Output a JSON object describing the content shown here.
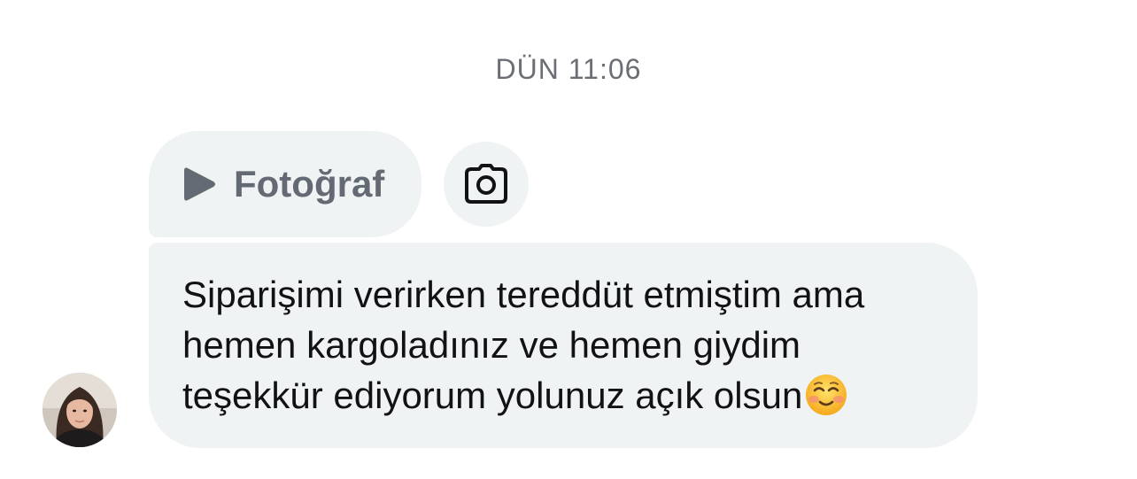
{
  "conversation": {
    "timestamp": "DÜN 11:06"
  },
  "photo_message": {
    "label": "Fotoğraf",
    "icon": "play-icon"
  },
  "camera_button": {
    "icon": "camera-icon"
  },
  "text_message": {
    "lines": [
      "Siparişimi verirken tereddüt etmiştim ama",
      "hemen kargoladınız ve hemen giydim",
      "teşekkür ediyorum yolunuz açık olsun"
    ],
    "emoji": "smiling-face-icon"
  },
  "sender": {
    "avatar": "avatar-photo"
  },
  "colors": {
    "bubble_bg": "#f0f3f4",
    "timestamp_text": "#6b6e74",
    "message_text": "#111214",
    "photo_label": "#646a73"
  }
}
